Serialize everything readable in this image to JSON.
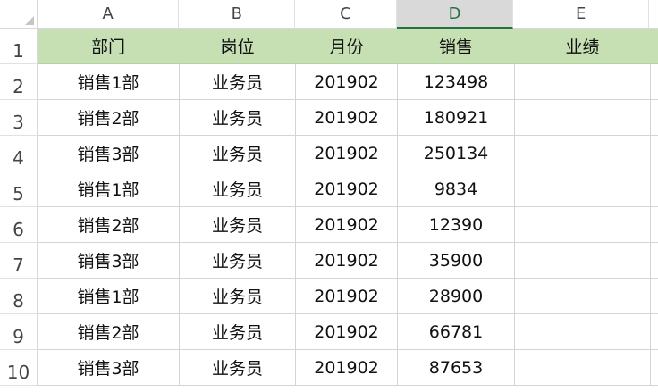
{
  "columns": [
    "A",
    "B",
    "C",
    "D",
    "E"
  ],
  "active_column": "D",
  "row_numbers": [
    "1",
    "2",
    "3",
    "4",
    "5",
    "6",
    "7",
    "8",
    "9",
    "10"
  ],
  "header": [
    "部门",
    "岗位",
    "月份",
    "销售",
    "业绩"
  ],
  "rows": [
    [
      "销售1部",
      "业务员",
      "201902",
      "123498",
      ""
    ],
    [
      "销售2部",
      "业务员",
      "201902",
      "180921",
      ""
    ],
    [
      "销售3部",
      "业务员",
      "201902",
      "250134",
      ""
    ],
    [
      "销售1部",
      "业务员",
      "201902",
      "9834",
      ""
    ],
    [
      "销售2部",
      "业务员",
      "201902",
      "12390",
      ""
    ],
    [
      "销售3部",
      "业务员",
      "201902",
      "35900",
      ""
    ],
    [
      "销售1部",
      "业务员",
      "201902",
      "28900",
      ""
    ],
    [
      "销售2部",
      "业务员",
      "201902",
      "66781",
      ""
    ],
    [
      "销售3部",
      "业务员",
      "201902",
      "87653",
      ""
    ]
  ],
  "colors": {
    "header_fill": "#c6e0b4",
    "active_column_accent": "#217346",
    "gridline": "#d4d4d4"
  }
}
